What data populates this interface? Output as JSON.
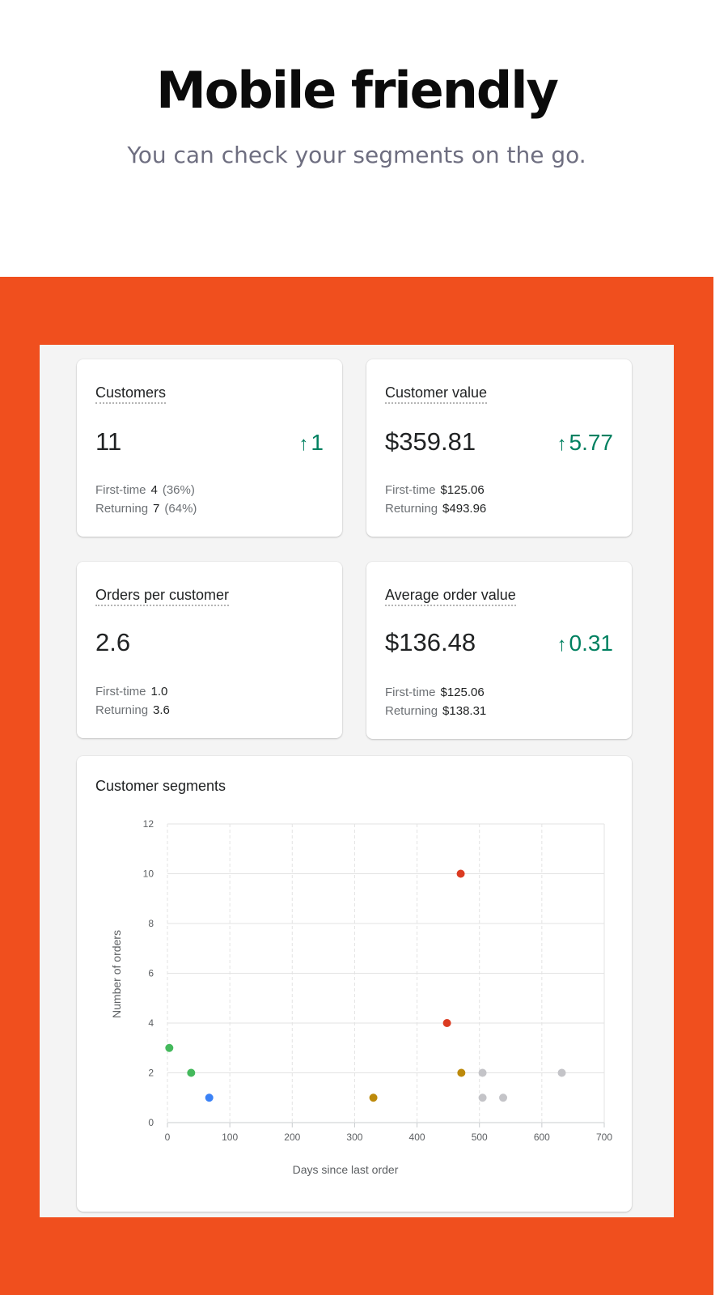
{
  "hero": {
    "title": "Mobile friendly",
    "subtitle": "You can check your segments on the go."
  },
  "colors": {
    "background_band": "#f04f1e",
    "positive": "#008060"
  },
  "metrics": {
    "customers": {
      "title": "Customers",
      "value": "11",
      "change": "1",
      "change_icon": "arrow-up-icon",
      "rows": [
        {
          "label": "First-time",
          "value": "4",
          "pct": "(36%)"
        },
        {
          "label": "Returning",
          "value": "7",
          "pct": "(64%)"
        }
      ]
    },
    "customer_value": {
      "title": "Customer value",
      "value": "$359.81",
      "change": "5.77",
      "change_icon": "arrow-up-icon",
      "rows": [
        {
          "label": "First-time",
          "value": "$125.06"
        },
        {
          "label": "Returning",
          "value": "$493.96"
        }
      ]
    },
    "orders_per_customer": {
      "title": "Orders per customer",
      "value": "2.6",
      "rows": [
        {
          "label": "First-time",
          "value": "1.0"
        },
        {
          "label": "Returning",
          "value": "3.6"
        }
      ]
    },
    "average_order_value": {
      "title": "Average order value",
      "value": "$136.48",
      "change": "0.31",
      "change_icon": "arrow-up-icon",
      "rows": [
        {
          "label": "First-time",
          "value": "$125.06"
        },
        {
          "label": "Returning",
          "value": "$138.31"
        }
      ]
    }
  },
  "segments_title": "Customer segments",
  "chart_data": {
    "type": "scatter",
    "title": "Customer segments",
    "xlabel": "Days since last order",
    "ylabel": "Number of orders",
    "xlim": [
      0,
      700
    ],
    "ylim": [
      0,
      12
    ],
    "xticks": [
      0,
      100,
      200,
      300,
      400,
      500,
      600,
      700
    ],
    "yticks": [
      0,
      2,
      4,
      6,
      8,
      10,
      12
    ],
    "grid": true,
    "points": [
      {
        "x": 3,
        "y": 3,
        "color": "#44b95c"
      },
      {
        "x": 38,
        "y": 2,
        "color": "#44b95c"
      },
      {
        "x": 67,
        "y": 1,
        "color": "#3b82f6"
      },
      {
        "x": 330,
        "y": 1,
        "color": "#bd8a0b"
      },
      {
        "x": 448,
        "y": 4,
        "color": "#db3b21"
      },
      {
        "x": 470,
        "y": 10,
        "color": "#db3b21"
      },
      {
        "x": 471,
        "y": 2,
        "color": "#bd8a0b"
      },
      {
        "x": 505,
        "y": 2,
        "color": "#c4c4c8"
      },
      {
        "x": 505,
        "y": 1,
        "color": "#c4c4c8"
      },
      {
        "x": 538,
        "y": 1,
        "color": "#c4c4c8"
      },
      {
        "x": 632,
        "y": 2,
        "color": "#c4c4c8"
      }
    ]
  }
}
